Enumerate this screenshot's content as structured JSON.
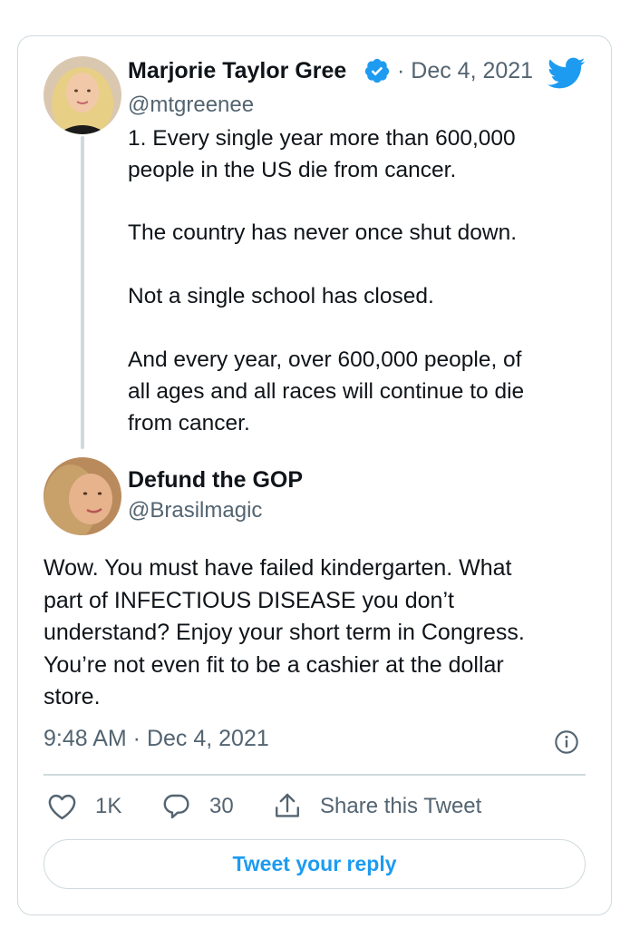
{
  "original": {
    "name": "Marjorie Taylor Gree",
    "handle": "@mtgreenee",
    "date": "· Dec 4, 2021",
    "lines": [
      "1. Every single year more than 600,000",
      "people in the US die from cancer.",
      "The country has never once shut down.",
      "Not a single school has closed.",
      "And every year, over 600,000 people, of",
      "all ages and all races will continue to die",
      "from cancer."
    ]
  },
  "reply": {
    "name": "Defund the GOP",
    "handle": "@Brasilmagic",
    "lines": [
      "Wow. You must have failed kindergarten. What",
      "part of INFECTIOUS DISEASE you don’t",
      "understand? Enjoy your short term in Congress.",
      "You’re not even fit to be a cashier at the dollar",
      "store."
    ]
  },
  "timestamp": "9:48 AM · Dec 4, 2021",
  "actions": {
    "like_count": "1K",
    "reply_count": "30",
    "share_label": "Share this Tweet"
  },
  "reply_button_label": "Tweet your reply",
  "colors": {
    "accent": "#1d9bf0",
    "twitter_bird": "#1d9bf0",
    "muted_text": "#536471",
    "border": "#cfd9de"
  },
  "icons": [
    "verified-badge-icon",
    "twitter-bird-icon",
    "info-icon",
    "heart-icon",
    "reply-icon",
    "share-icon"
  ]
}
